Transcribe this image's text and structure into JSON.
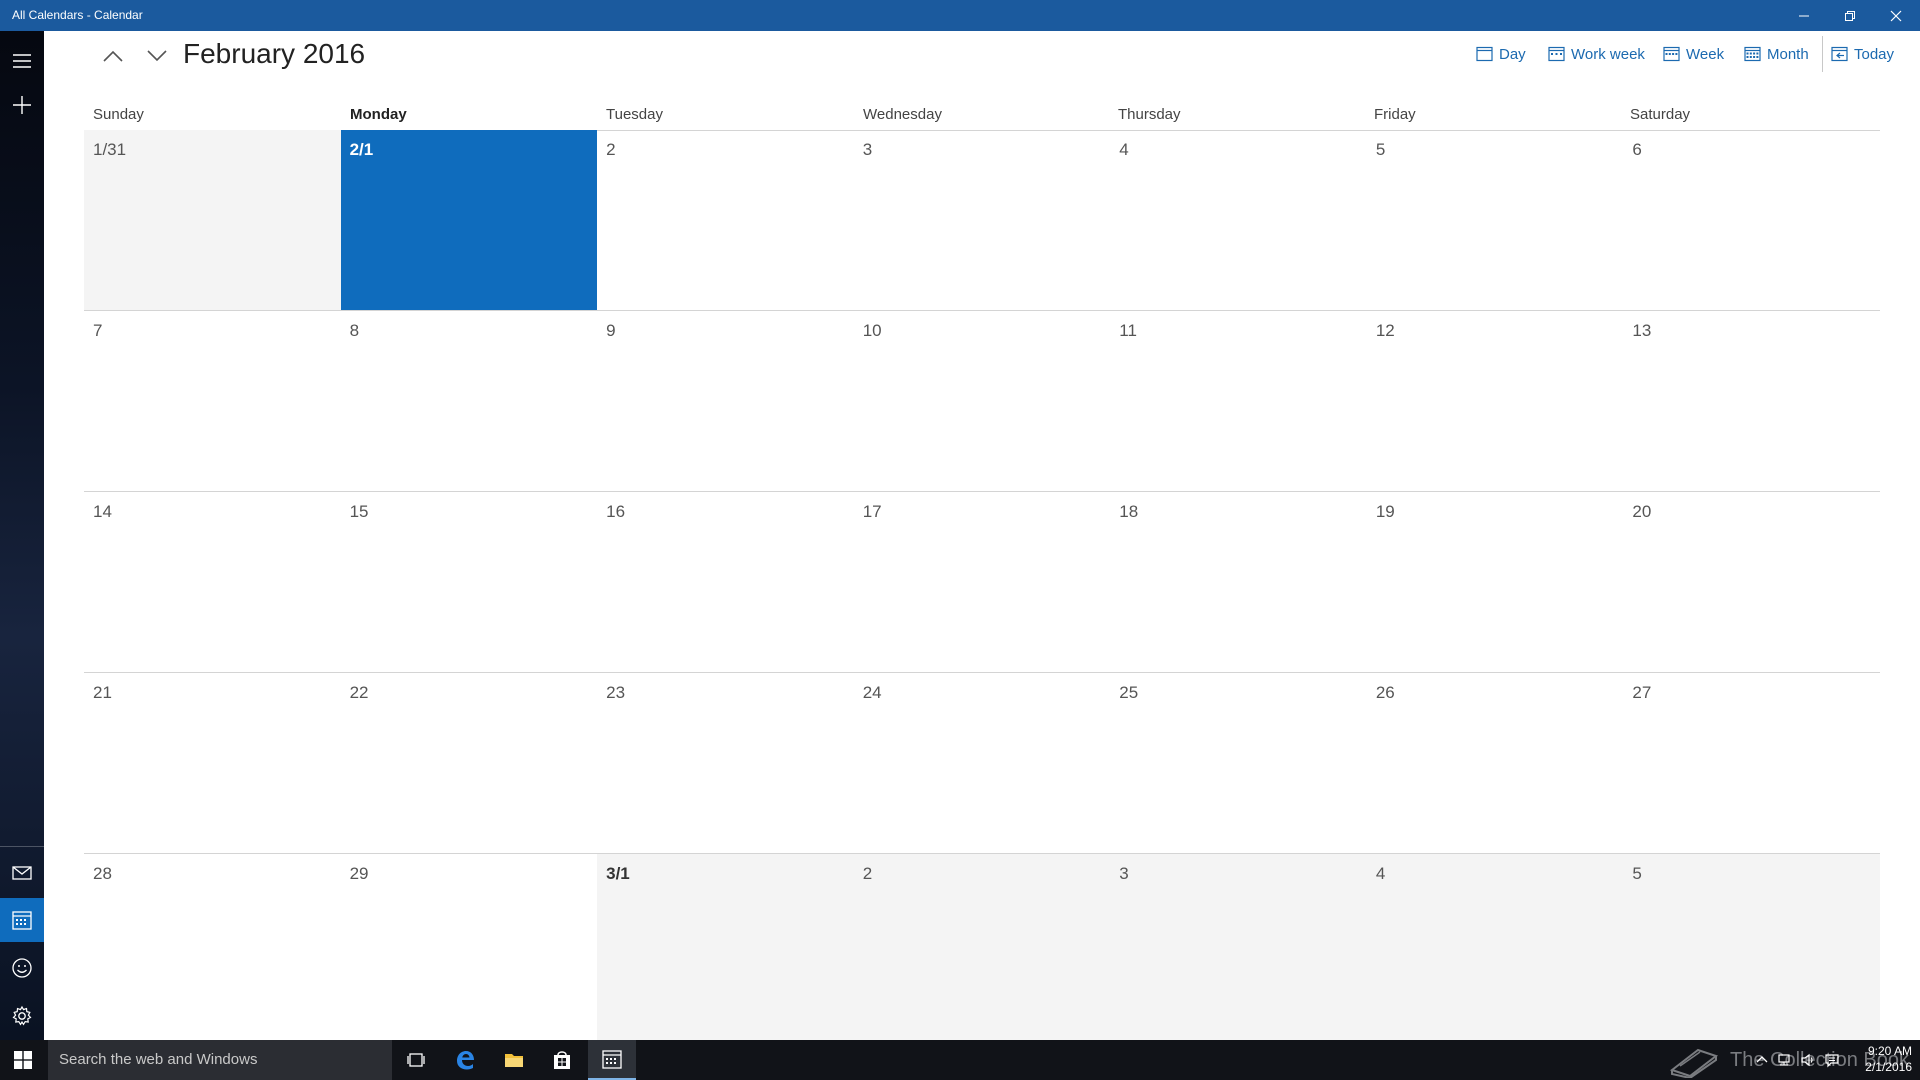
{
  "window": {
    "title": "All Calendars - Calendar",
    "accent": "#1b5a9e"
  },
  "rail": {
    "icons": [
      "hamburger-icon",
      "plus-icon",
      "mail-icon",
      "calendar-icon",
      "smiley-icon",
      "gear-icon"
    ],
    "active": "calendar-icon"
  },
  "header": {
    "title": "February 2016",
    "views": [
      {
        "label": "Day",
        "icon": "day-view-icon"
      },
      {
        "label": "Work week",
        "icon": "workweek-view-icon"
      },
      {
        "label": "Week",
        "icon": "week-view-icon"
      },
      {
        "label": "Month",
        "icon": "month-view-icon"
      },
      {
        "label": "Today",
        "icon": "today-icon"
      }
    ]
  },
  "calendar": {
    "weekdays": [
      "Sunday",
      "Monday",
      "Tuesday",
      "Wednesday",
      "Thursday",
      "Friday",
      "Saturday"
    ],
    "current_weekday": "Monday",
    "today_color": "#0f6cbd",
    "weeks": [
      [
        "1/31",
        "2/1",
        "2",
        "3",
        "4",
        "5",
        "6"
      ],
      [
        "7",
        "8",
        "9",
        "10",
        "11",
        "12",
        "13"
      ],
      [
        "14",
        "15",
        "16",
        "17",
        "18",
        "19",
        "20"
      ],
      [
        "21",
        "22",
        "23",
        "24",
        "25",
        "26",
        "27"
      ],
      [
        "28",
        "29",
        "3/1",
        "2",
        "3",
        "4",
        "5"
      ]
    ],
    "today": "2/1",
    "out_of_month": [
      "1/31",
      "3/1",
      "2",
      "3",
      "4",
      "5"
    ]
  },
  "taskbar": {
    "search_placeholder": "Search the web and Windows",
    "watermark": "The Collection Book",
    "time": "9:20 AM",
    "date": "2/1/2016"
  }
}
